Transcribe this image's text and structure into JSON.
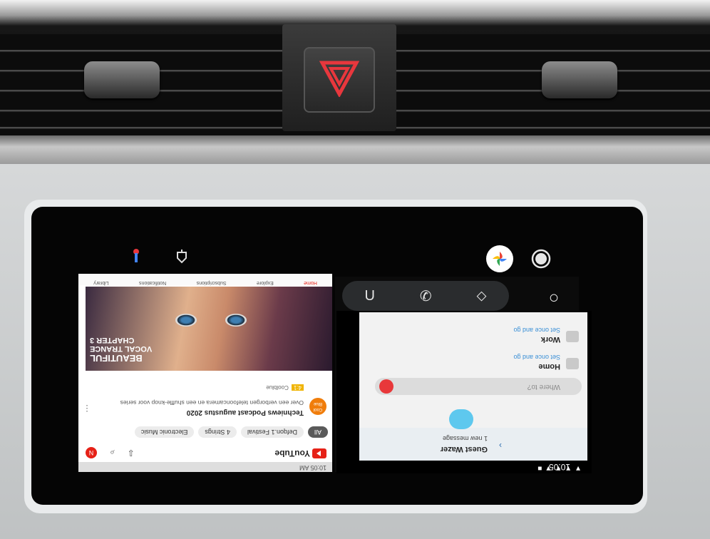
{
  "hazard": {
    "label": ""
  },
  "topbar": {
    "assistant_icon": "assistant-icon",
    "notification_icon": "notification-icon",
    "photos_icon": "google-photos-icon",
    "record_icon": "record-icon"
  },
  "dock": {
    "items": [
      "U",
      "✆",
      "⬦",
      "○"
    ]
  },
  "youtube": {
    "status_time": "10:05 AM",
    "logo": "YouTube",
    "avatar": "N",
    "chips": [
      "All",
      "Defqon.1 Festival",
      "4 Strings",
      "Electronic Music"
    ],
    "video_title": "Techniews Podcast augustus 2020",
    "video_sub": "Over een verborgen telefooncamera en een shuffle-knop voor series",
    "channel": "Techniews",
    "badge": "4:1",
    "badge_text": "Coolblue",
    "thumb_title_1": "BEAUTIFUL",
    "thumb_title_2": "VOCAL TRANCE",
    "thumb_title_3": "CHAPTER 3",
    "nav": [
      "Home",
      "Explore",
      "Subscriptions",
      "Notifications",
      "Library"
    ]
  },
  "waze": {
    "time": "10:05",
    "guest": "Guest Wazer",
    "message": "1 new message",
    "search_placeholder": "Where to?",
    "places": [
      {
        "name": "Home",
        "sub": "Set once and go"
      },
      {
        "name": "Work",
        "sub": "Set once and go"
      }
    ]
  },
  "colors": {
    "hazard_red": "#e8373d",
    "youtube_red": "#e62117",
    "waze_blue": "#5ec8ee",
    "photos_multicolor": "#34a853"
  }
}
